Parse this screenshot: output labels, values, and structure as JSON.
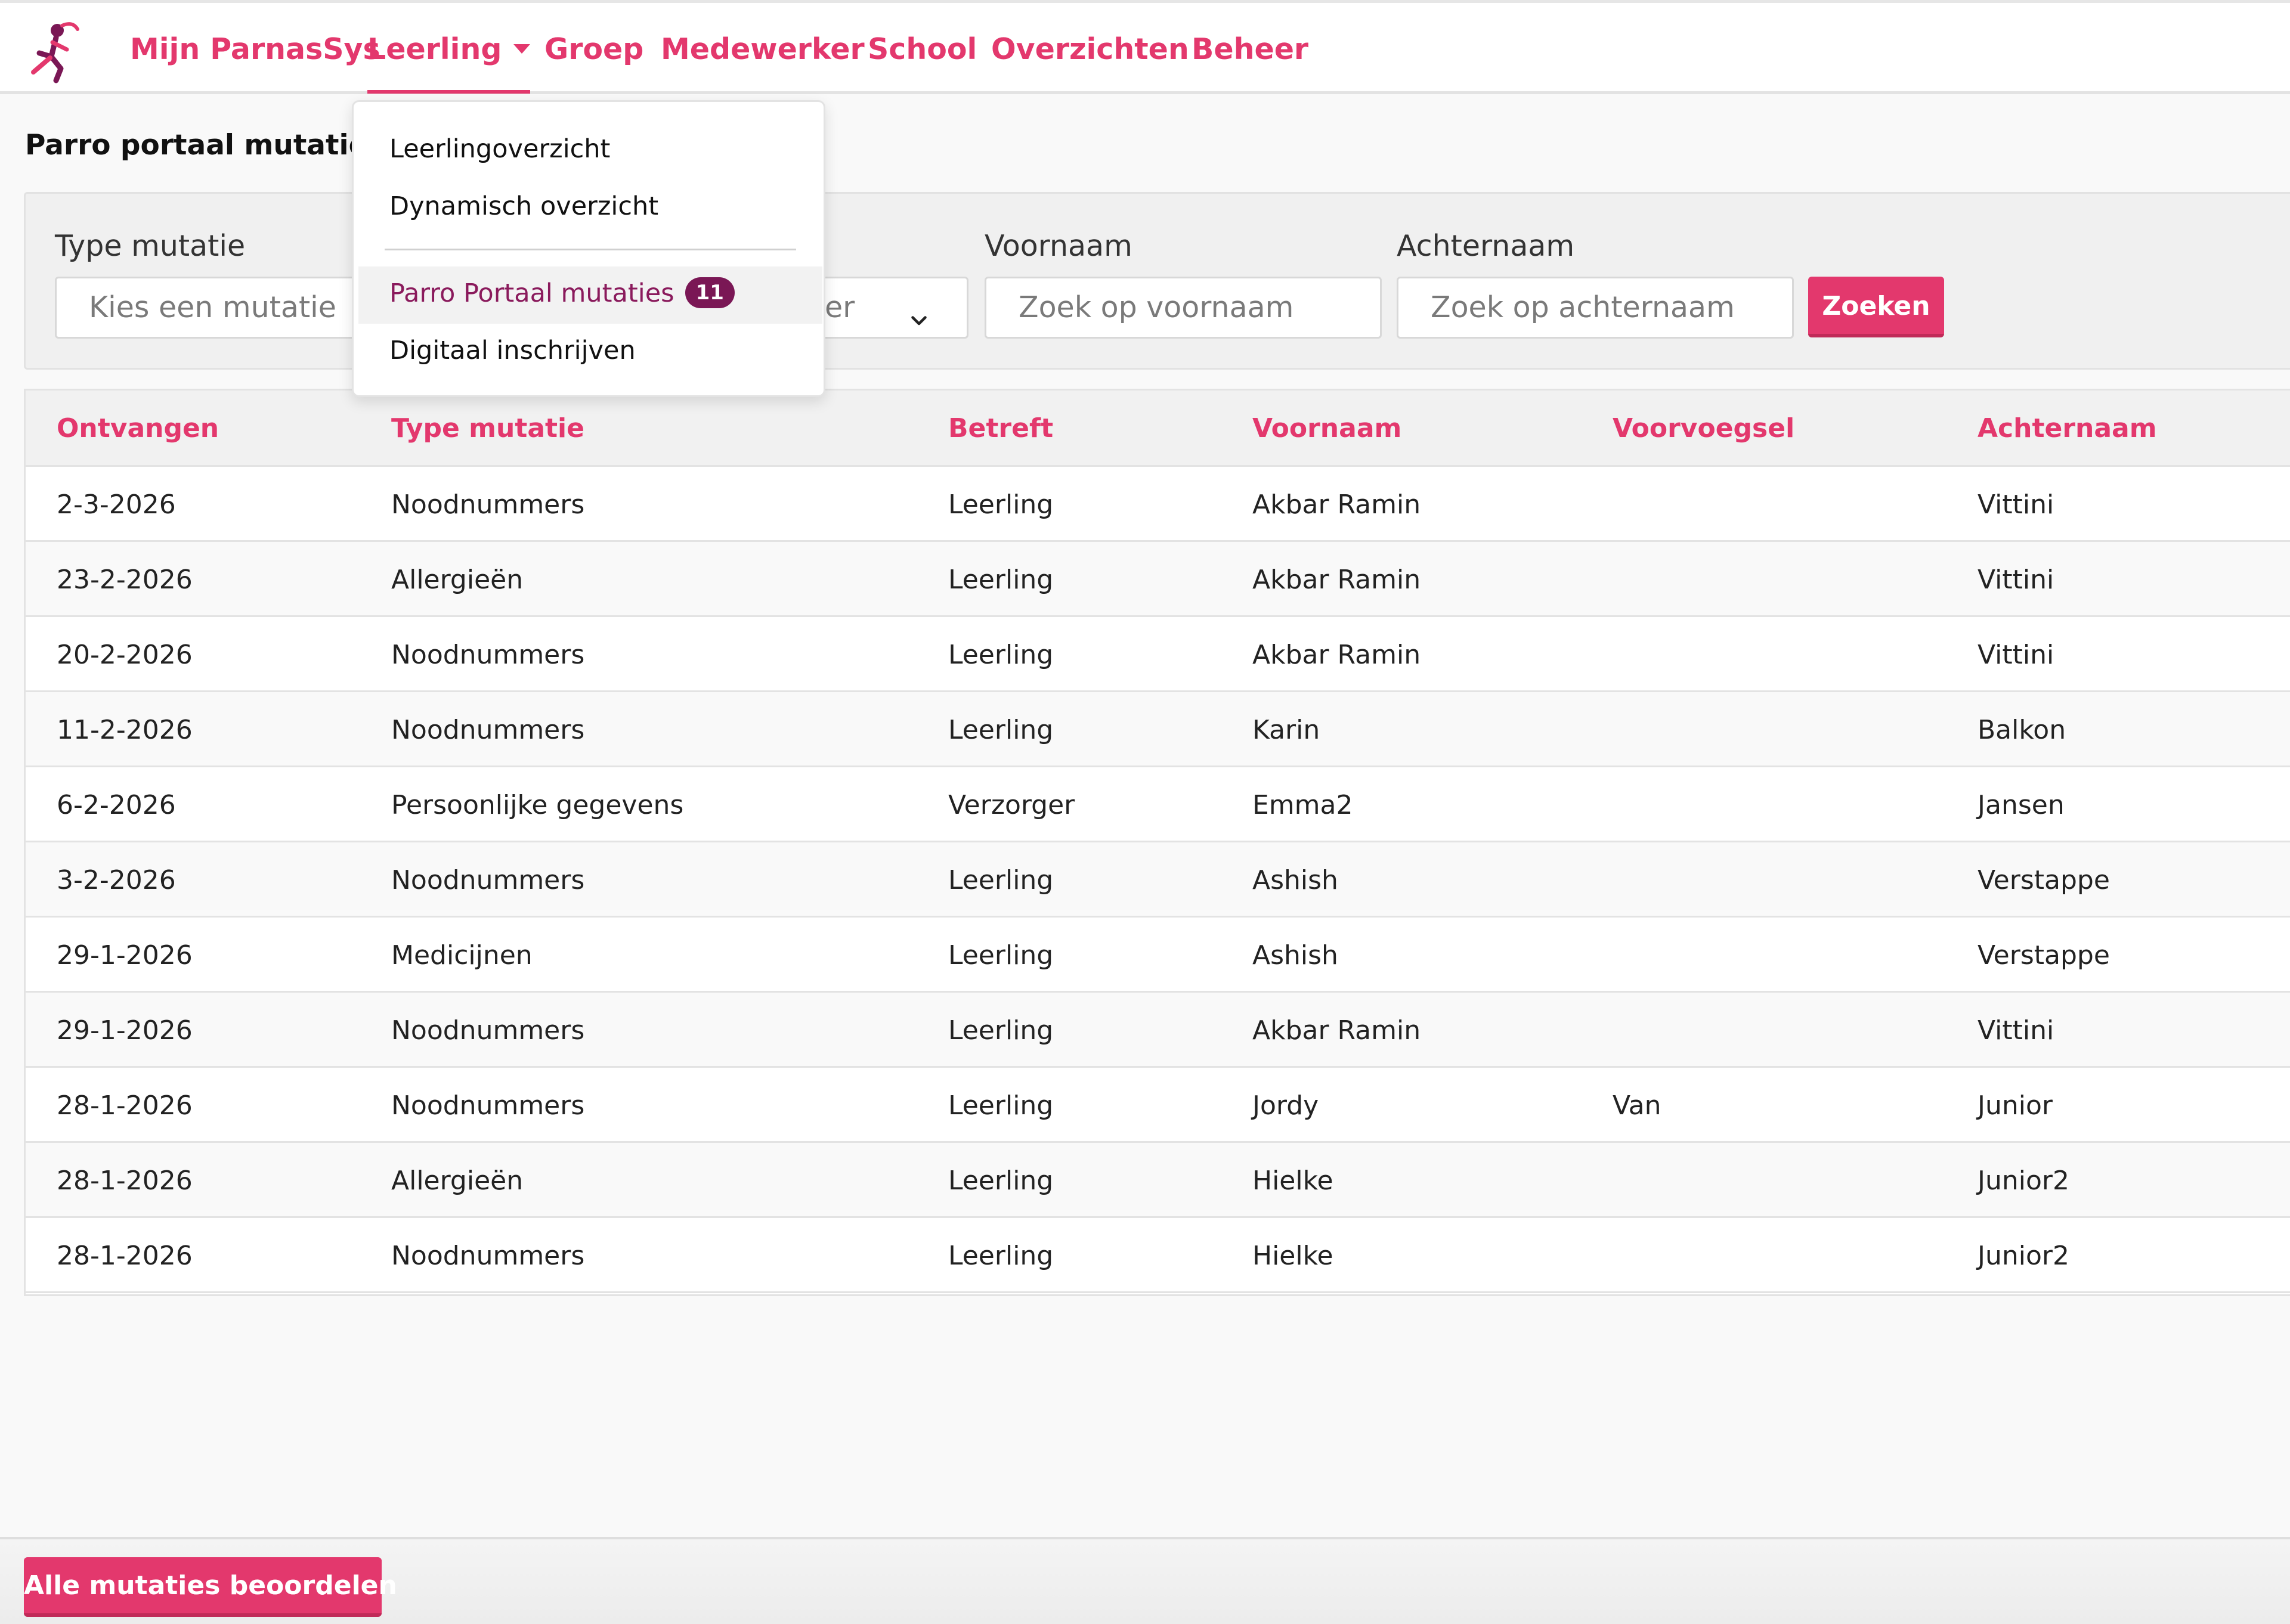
{
  "nav": {
    "items": [
      {
        "label": "Mijn ParnasSys"
      },
      {
        "label": "Leerling"
      },
      {
        "label": "Groep"
      },
      {
        "label": "Medewerker"
      },
      {
        "label": "School"
      },
      {
        "label": "Overzichten"
      },
      {
        "label": "Beheer"
      }
    ],
    "active": "Leerling"
  },
  "page": {
    "title": "Parro portaal mutaties"
  },
  "filters": {
    "type_label": "Type mutatie",
    "type_placeholder": "Kies een mutatie",
    "betreft_partial": "er",
    "voornaam_label": "Voornaam",
    "voornaam_placeholder": "Zoek op voornaam",
    "achternaam_label": "Achternaam",
    "achternaam_placeholder": "Zoek op achternaam",
    "search_button": "Zoeken"
  },
  "dropdown": {
    "items": [
      {
        "label": "Leerlingoverzicht"
      },
      {
        "label": "Dynamisch overzicht"
      },
      {
        "label": "Parro Portaal mutaties",
        "badge": "11"
      },
      {
        "label": "Digitaal inschrijven"
      }
    ]
  },
  "table": {
    "headers": [
      "Ontvangen",
      "Type mutatie",
      "Betreft",
      "Voornaam",
      "Voorvoegsel",
      "Achternaam"
    ],
    "rows": [
      [
        "2-3-2026",
        "Noodnummers",
        "Leerling",
        "Akbar Ramin",
        "",
        "Vittini"
      ],
      [
        "23-2-2026",
        "Allergieën",
        "Leerling",
        "Akbar Ramin",
        "",
        "Vittini"
      ],
      [
        "20-2-2026",
        "Noodnummers",
        "Leerling",
        "Akbar Ramin",
        "",
        "Vittini"
      ],
      [
        "11-2-2026",
        "Noodnummers",
        "Leerling",
        "Karin",
        "",
        "Balkon"
      ],
      [
        "6-2-2026",
        "Persoonlijke gegevens",
        "Verzorger",
        "Emma2",
        "",
        "Jansen"
      ],
      [
        "3-2-2026",
        "Noodnummers",
        "Leerling",
        "Ashish",
        "",
        "Verstappe"
      ],
      [
        "29-1-2026",
        "Medicijnen",
        "Leerling",
        "Ashish",
        "",
        "Verstappe"
      ],
      [
        "29-1-2026",
        "Noodnummers",
        "Leerling",
        "Akbar Ramin",
        "",
        "Vittini"
      ],
      [
        "28-1-2026",
        "Noodnummers",
        "Leerling",
        "Jordy",
        "Van",
        "Junior"
      ],
      [
        "28-1-2026",
        "Allergieën",
        "Leerling",
        "Hielke",
        "",
        "Junior2"
      ],
      [
        "28-1-2026",
        "Noodnummers",
        "Leerling",
        "Hielke",
        "",
        "Junior2"
      ]
    ]
  },
  "footer": {
    "review_all_button": "Alle mutaties beoordelen"
  },
  "colors": {
    "accent": "#e3386d",
    "badge": "#7a1755",
    "active_item": "#8a1a5c"
  }
}
